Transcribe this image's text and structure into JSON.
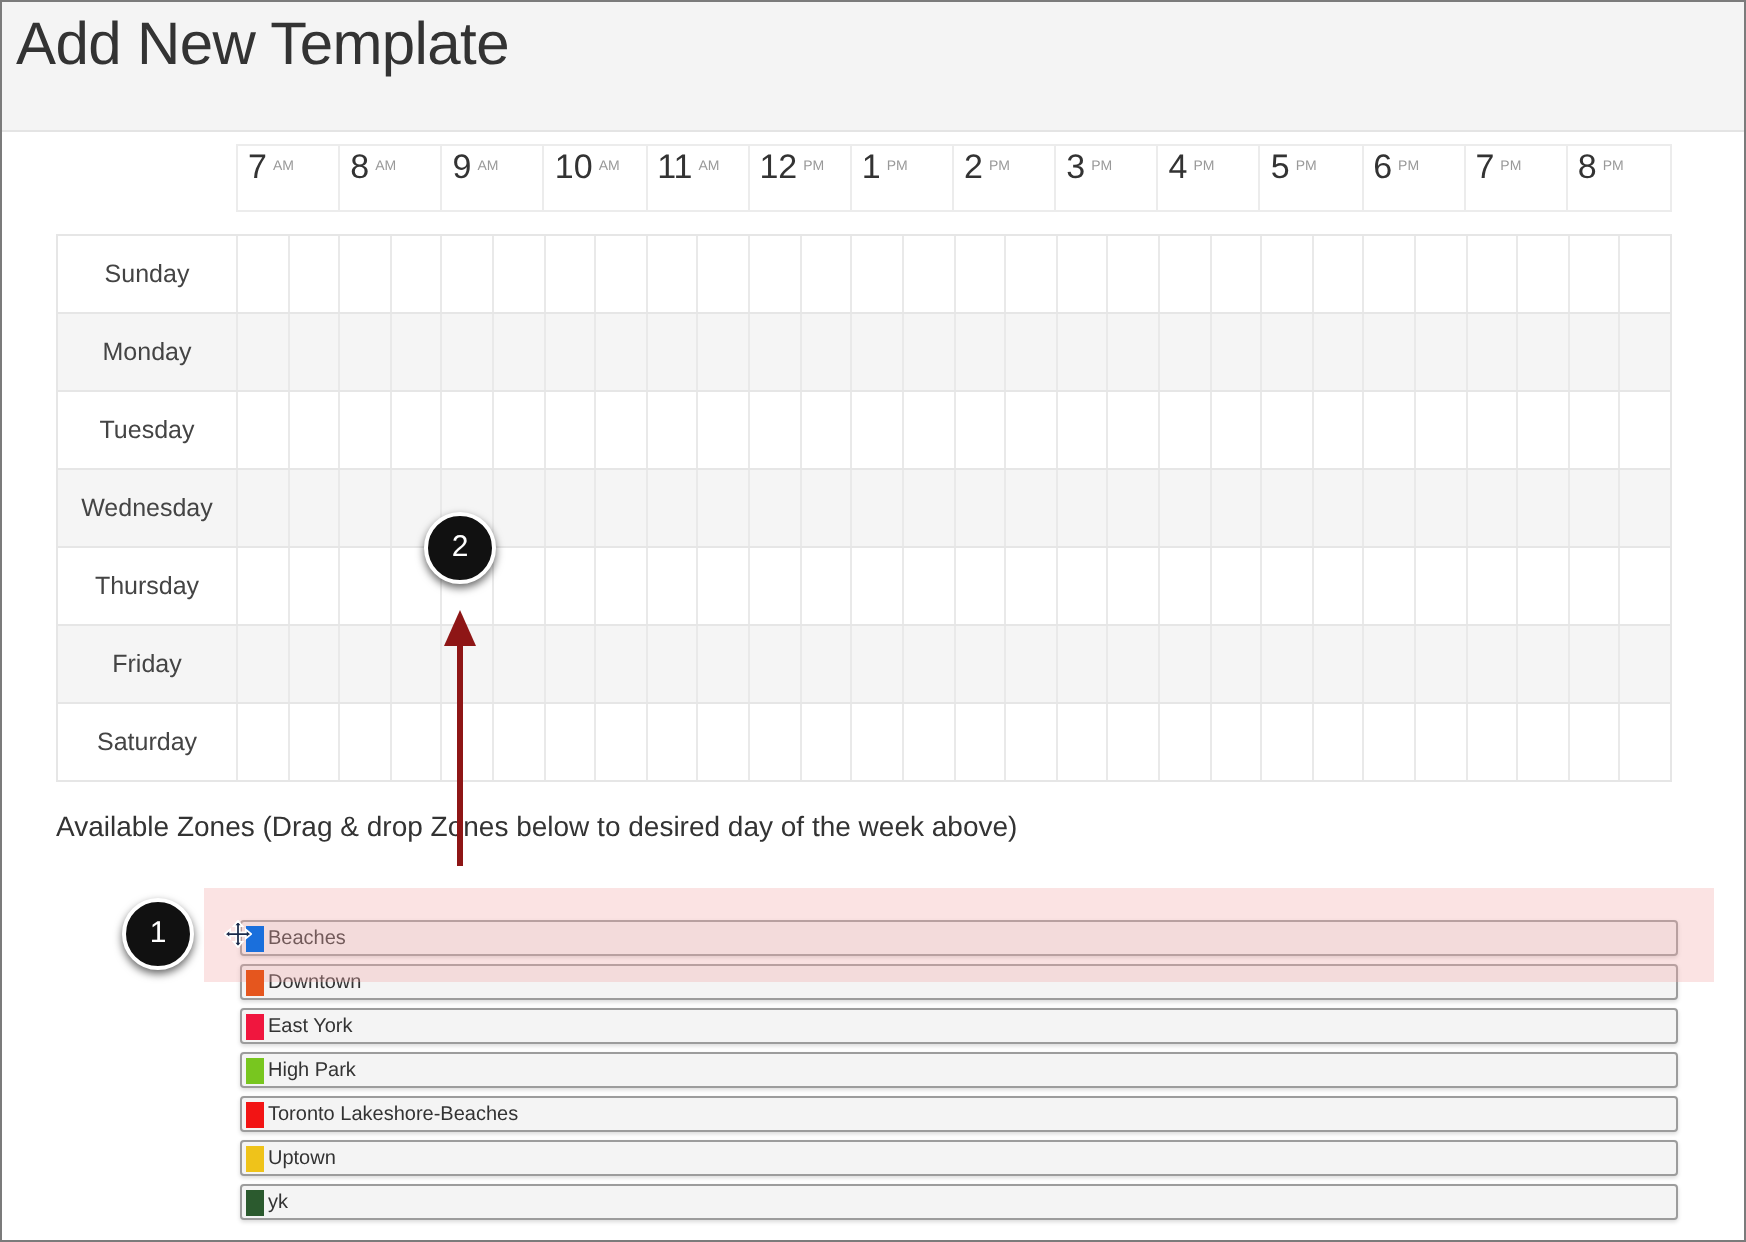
{
  "page": {
    "title": "Add New Template"
  },
  "schedule": {
    "hours": [
      {
        "hour": "7",
        "period": "AM"
      },
      {
        "hour": "8",
        "period": "AM"
      },
      {
        "hour": "9",
        "period": "AM"
      },
      {
        "hour": "10",
        "period": "AM"
      },
      {
        "hour": "11",
        "period": "AM"
      },
      {
        "hour": "12",
        "period": "PM"
      },
      {
        "hour": "1",
        "period": "PM"
      },
      {
        "hour": "2",
        "period": "PM"
      },
      {
        "hour": "3",
        "period": "PM"
      },
      {
        "hour": "4",
        "period": "PM"
      },
      {
        "hour": "5",
        "period": "PM"
      },
      {
        "hour": "6",
        "period": "PM"
      },
      {
        "hour": "7",
        "period": "PM"
      },
      {
        "hour": "8",
        "period": "PM"
      }
    ],
    "days": [
      "Sunday",
      "Monday",
      "Tuesday",
      "Wednesday",
      "Thursday",
      "Friday",
      "Saturday"
    ]
  },
  "zones_heading": "Available Zones (Drag & drop Zones below to desired day of the week above)",
  "zones": [
    {
      "name": "Beaches",
      "color": "#1a6fdc"
    },
    {
      "name": "Downtown",
      "color": "#e5561e"
    },
    {
      "name": "East York",
      "color": "#f0163e"
    },
    {
      "name": "High Park",
      "color": "#78c61f"
    },
    {
      "name": "Toronto Lakeshore-Beaches",
      "color": "#f21414"
    },
    {
      "name": "Uptown",
      "color": "#efc31a"
    },
    {
      "name": "yk",
      "color": "#2b5a2e"
    }
  ],
  "callouts": [
    {
      "label": "1"
    },
    {
      "label": "2"
    }
  ]
}
